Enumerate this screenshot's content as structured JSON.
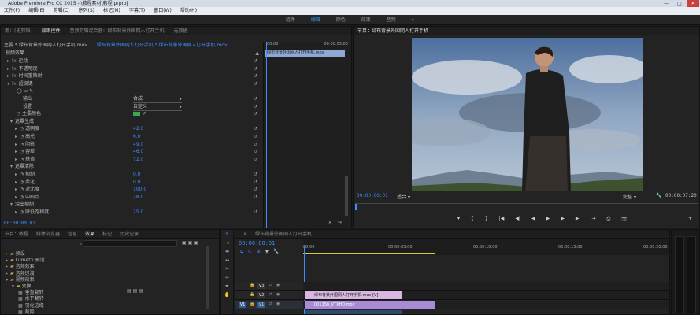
{
  "window": {
    "title": "Adobe Premiere Pro CC 2015 - \\教程素材\\教程.prproj",
    "minimize": "—",
    "maximize": "□",
    "close": "✕"
  },
  "menu": [
    "文件(F)",
    "编辑(E)",
    "剪辑(C)",
    "序列(S)",
    "标记(M)",
    "字幕(T)",
    "窗口(W)",
    "帮助(H)"
  ],
  "workspaces": [
    "组件",
    "编辑",
    "颜色",
    "效果",
    "音频"
  ],
  "workspace_more": "»",
  "effect_controls": {
    "tabs": [
      "源：(无剪辑)",
      "效果控件",
      "音频剪辑混合器：绿布背景外国网人打开手机",
      "元数据"
    ],
    "master": "主要 * 绿布背景外国网人打开手机.mov",
    "clip": "绿布背景外国网人打开手机 * 绿布背景外国网人打开手机.mov",
    "section": "视频效果",
    "effects": [
      "运动",
      "不透明度",
      "时间重映射",
      "超级键"
    ],
    "output_label": "输出",
    "output_value": "合成",
    "setting_label": "设置",
    "setting_value": "自定义",
    "key_color_label": "主要颜色",
    "matte_gen": "遮罩生成",
    "matte_items": [
      {
        "n": "透明度",
        "v": "42.0"
      },
      {
        "n": "高光",
        "v": "6.0"
      },
      {
        "n": "阴影",
        "v": "49.0"
      },
      {
        "n": "容差",
        "v": "46.0"
      },
      {
        "n": "基值",
        "v": "72.0"
      }
    ],
    "matte_clean": "遮罩清除",
    "clean_items": [
      {
        "n": "抑制",
        "v": "0.0"
      },
      {
        "n": "柔化",
        "v": "0.0"
      },
      {
        "n": "对比度",
        "v": "100.0"
      },
      {
        "n": "中间点",
        "v": "28.0"
      }
    ],
    "spill": "溢出抑制",
    "spill_items": [
      {
        "n": "降低饱和度",
        "v": "25.0"
      }
    ],
    "timecode": "00:00:00:01",
    "ruler_start": "00:00",
    "ruler_end": "00:00:05:00",
    "clip_bar": "绿布背景外国网人打开手机.mov"
  },
  "program": {
    "title": "节目：绿布背景外国网人打开手机",
    "timecode": "00:00:00:01",
    "fit": "适合",
    "quality": "完整",
    "duration": "00:00:07:20",
    "controls": [
      "▾",
      "{",
      "}",
      "|◀",
      "◀|",
      "◀",
      "▶",
      "▶",
      "▶|",
      "⇥",
      "⎙",
      "📷"
    ]
  },
  "project": {
    "tabs": [
      "节目：教程",
      "媒体浏览器",
      "信息",
      "效果",
      "标记",
      "历史记录"
    ],
    "tree": [
      {
        "label": "预设",
        "depth": 0
      },
      {
        "label": "Lumetri 预设",
        "depth": 0
      },
      {
        "label": "音频效果",
        "depth": 0
      },
      {
        "label": "音频过渡",
        "depth": 0
      },
      {
        "label": "视频效果",
        "depth": 0
      },
      {
        "label": "变换",
        "depth": 1
      },
      {
        "label": "垂直翻转",
        "depth": 2
      },
      {
        "label": "水平翻转",
        "depth": 2
      },
      {
        "label": "羽化边缘",
        "depth": 2
      },
      {
        "label": "裁剪",
        "depth": 2
      }
    ]
  },
  "timeline": {
    "title": "绿布背景外国网人打开手机",
    "timecode": "00:00:00:01",
    "ruler": [
      "00:00",
      "00:00:05:00",
      "00:00:10:00",
      "00:00:15:00",
      "00:00:20:00"
    ],
    "tracks": [
      {
        "name": "V3"
      },
      {
        "name": "V2"
      },
      {
        "name": "V1",
        "src": "V1"
      }
    ],
    "clips": [
      {
        "label": "绿布背景外国网人打开手机.mov [V]",
        "color": "#d8b8e0"
      },
      {
        "label": "001158_VTXHD.mov",
        "color": "#a98ad6"
      }
    ]
  },
  "colors": {
    "accent": "#3d8cff",
    "keycolor": "#3ea84e",
    "clip_v2": "#d8b8e0",
    "clip_v1": "#a98ad6"
  }
}
